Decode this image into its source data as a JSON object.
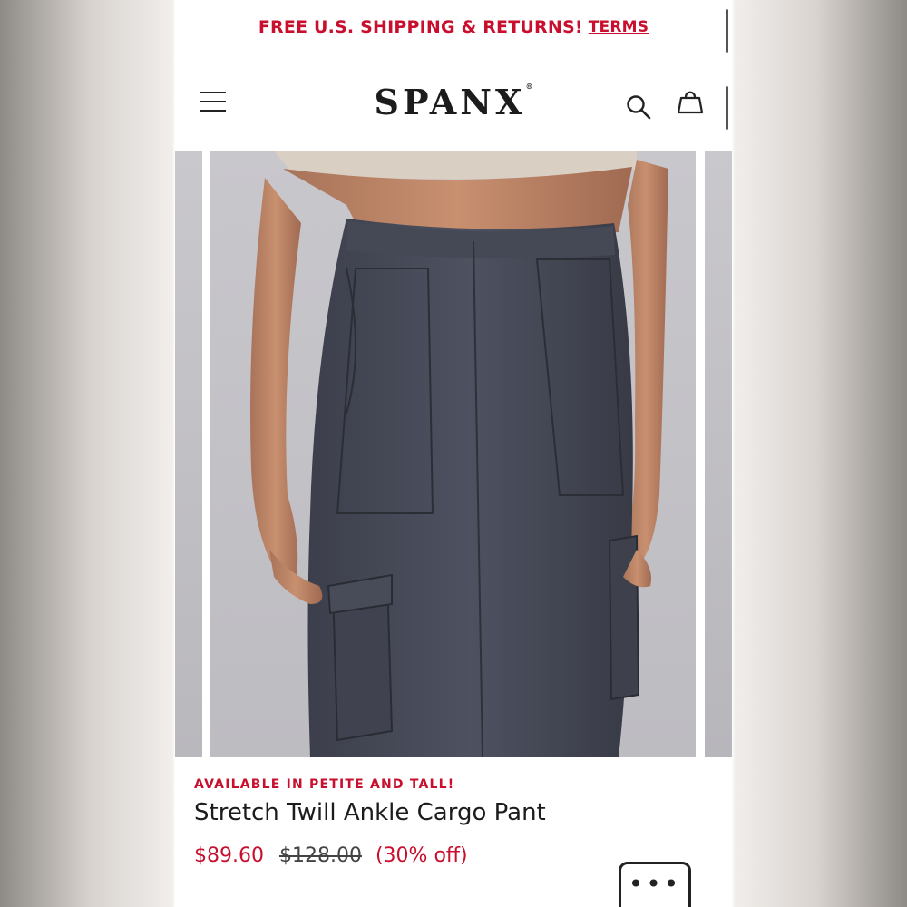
{
  "promo": {
    "text": "FREE U.S. SHIPPING & RETURNS!",
    "link": "TERMS",
    "color": "#c8102e"
  },
  "header": {
    "logo": "SPANX",
    "logo_mark": "®",
    "menu_icon": "hamburger-icon",
    "search_icon": "search-icon",
    "bag_icon": "shopping-bag-icon"
  },
  "product": {
    "availability": "AVAILABLE IN PETITE AND TALL!",
    "name": "Stretch Twill Ankle Cargo Pant",
    "price_sale": "$89.60",
    "price_original": "$128.00",
    "discount": "(30% off)"
  },
  "chat": {
    "icon": "more-dots-icon",
    "label": "•••"
  }
}
